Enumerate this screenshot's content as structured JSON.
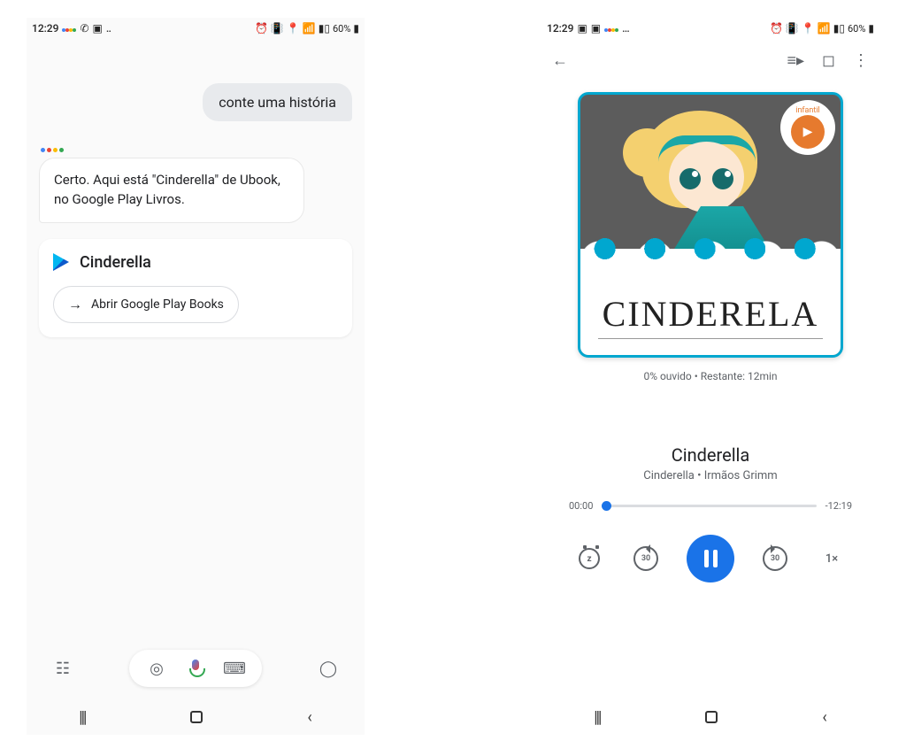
{
  "status": {
    "time": "12:29",
    "battery": "60%",
    "left_icons": [
      "G",
      "whatsapp",
      "image",
      "…"
    ],
    "left_icons2": [
      "image1",
      "image2",
      "G",
      "…"
    ],
    "right_icons": [
      "alarm",
      "vibrate",
      "location",
      "wifi",
      "signal1",
      "signal2"
    ]
  },
  "assistant": {
    "user_message": "conte uma história",
    "response": "Certo. Aqui está \"Cinderella\" de Ubook, no Google Play Livros.",
    "card_title": "Cinderella",
    "card_action": "Abrir Google Play Books"
  },
  "bottombar": {
    "left": "updates",
    "lens": "lens",
    "mic": "mic",
    "keyboard": "keyboard",
    "explore": "explore"
  },
  "player": {
    "cover_title": "CINDERELA",
    "badge_label": "infantil",
    "progress_text": "0% ouvido • Restante: 12min",
    "track_title": "Cinderella",
    "track_subtitle": "Cinderella • Irmãos Grimm",
    "elapsed": "00:00",
    "remaining": "-12:19",
    "rewind": "30",
    "forward": "30",
    "speed": "1×"
  },
  "nav": {
    "recent": "|||",
    "back": "‹"
  }
}
